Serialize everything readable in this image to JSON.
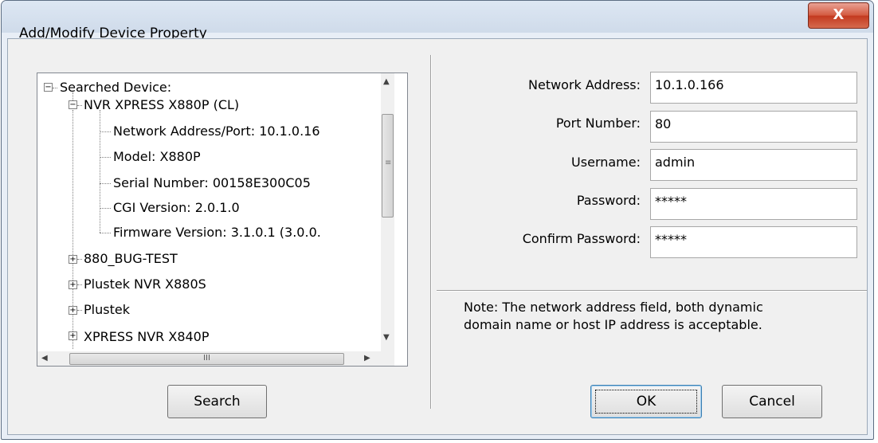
{
  "window": {
    "title": "Add/Modify Device Property",
    "close_label": "X"
  },
  "tree": {
    "root": "Searched Device:",
    "device": "NVR XPRESS X880P (CL)",
    "properties": [
      "Network Address/Port: 10.1.0.16",
      "Model: X880P",
      "Serial Number: 00158E300C05",
      "CGI Version: 2.0.1.0",
      "Firmware Version: 3.1.0.1 (3.0.0."
    ],
    "others": [
      "880_BUG-TEST",
      "Plustek NVR X880S",
      "Plustek",
      "XPRESS NVR X840P"
    ],
    "scroll_grip": "III"
  },
  "form": {
    "network_address": {
      "label": "Network Address:",
      "value": "10.1.0.166"
    },
    "port_number": {
      "label": "Port Number:",
      "value": "80"
    },
    "username": {
      "label": "Username:",
      "value": "admin"
    },
    "password": {
      "label": "Password:",
      "value": "*****"
    },
    "confirm_password": {
      "label": "Confirm Password:",
      "value": "*****"
    }
  },
  "note": {
    "line1": "Note: The network address field, both dynamic",
    "line2": "domain name or host IP address is acceptable."
  },
  "buttons": {
    "search": "Search",
    "ok": "OK",
    "cancel": "Cancel"
  }
}
